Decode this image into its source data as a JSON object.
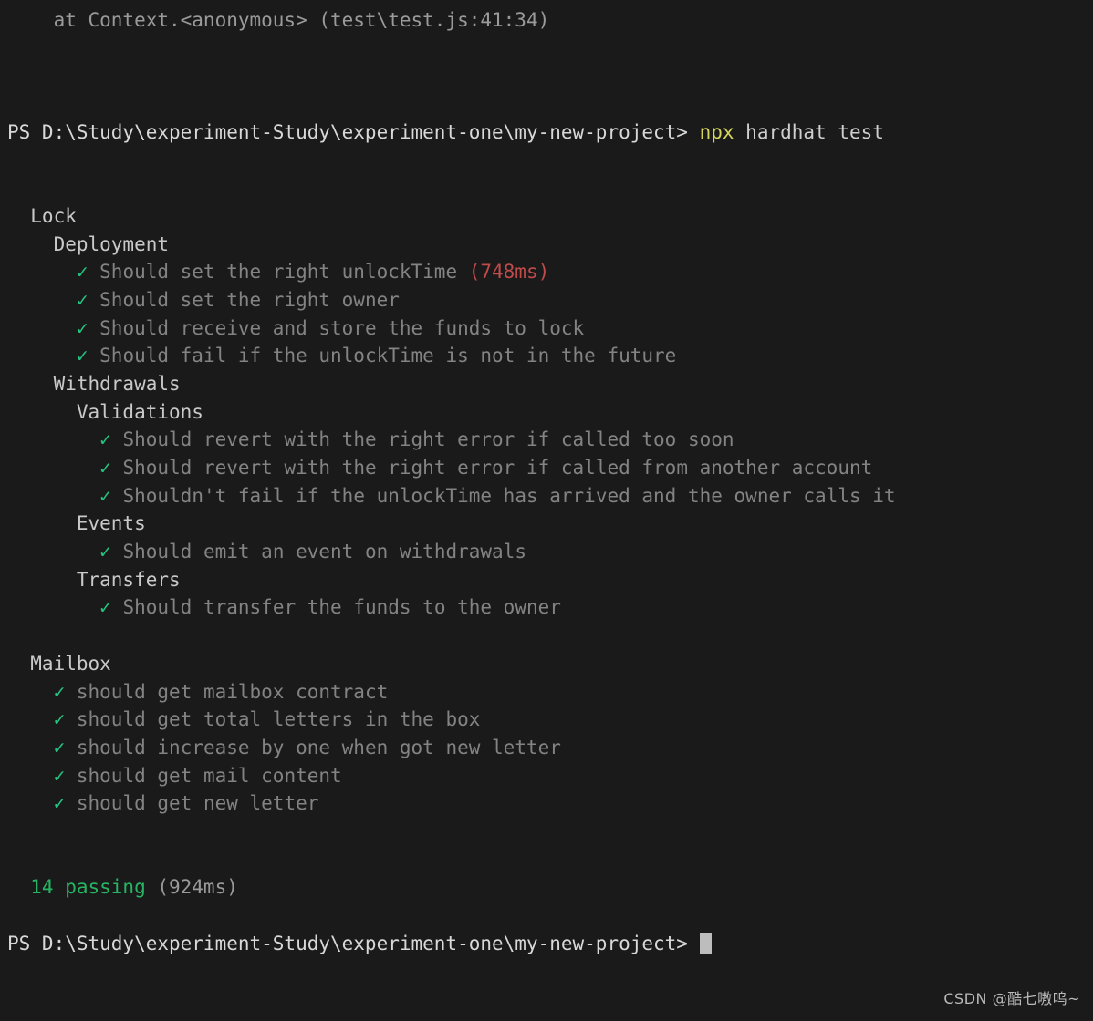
{
  "terminal": {
    "shell": "PowerShell",
    "background_color": "#1a1a1a",
    "colors": {
      "default_text": "#cfcfcf",
      "suite_heading": "#c9c9c9",
      "test_description": "#838383",
      "checkmark_green": "#26c281",
      "passing_green": "#27b563",
      "slow_duration_red": "#bf4b4b",
      "command_yellow": "#d6d65e",
      "cursor": "#bdbdbd"
    },
    "stack_trace_line": "    at Context.<anonymous> (test\\test.js:41:34)",
    "prompt": "PS D:\\Study\\experiment-Study\\experiment-one\\my-new-project>",
    "command": {
      "program": "npx",
      "args": "hardhat test"
    },
    "checkmark_glyph": "✓",
    "cursor_glyph": "block-cursor"
  },
  "test_output": {
    "suites": [
      {
        "name": "Lock",
        "indent": 2,
        "tests": [],
        "children": [
          {
            "name": "Deployment",
            "indent": 4,
            "tests": [
              {
                "title": "Should set the right unlockTime",
                "duration": "(748ms)",
                "duration_slow": true,
                "indent": 6
              },
              {
                "title": "Should set the right owner",
                "duration": "",
                "duration_slow": false,
                "indent": 6
              },
              {
                "title": "Should receive and store the funds to lock",
                "duration": "",
                "duration_slow": false,
                "indent": 6
              },
              {
                "title": "Should fail if the unlockTime is not in the future",
                "duration": "",
                "duration_slow": false,
                "indent": 6
              }
            ],
            "children": []
          },
          {
            "name": "Withdrawals",
            "indent": 4,
            "tests": [],
            "children": [
              {
                "name": "Validations",
                "indent": 6,
                "tests": [
                  {
                    "title": "Should revert with the right error if called too soon",
                    "duration": "",
                    "duration_slow": false,
                    "indent": 8
                  },
                  {
                    "title": "Should revert with the right error if called from another account",
                    "duration": "",
                    "duration_slow": false,
                    "indent": 8
                  },
                  {
                    "title": "Shouldn't fail if the unlockTime has arrived and the owner calls it",
                    "duration": "",
                    "duration_slow": false,
                    "indent": 8
                  }
                ],
                "children": []
              },
              {
                "name": "Events",
                "indent": 6,
                "tests": [
                  {
                    "title": "Should emit an event on withdrawals",
                    "duration": "",
                    "duration_slow": false,
                    "indent": 8
                  }
                ],
                "children": []
              },
              {
                "name": "Transfers",
                "indent": 6,
                "tests": [
                  {
                    "title": "Should transfer the funds to the owner",
                    "duration": "",
                    "duration_slow": false,
                    "indent": 8
                  }
                ],
                "children": []
              }
            ]
          }
        ]
      },
      {
        "name": "Mailbox",
        "indent": 2,
        "tests": [
          {
            "title": "should get mailbox contract",
            "duration": "",
            "duration_slow": false,
            "indent": 4
          },
          {
            "title": "should get total letters in the box",
            "duration": "",
            "duration_slow": false,
            "indent": 4
          },
          {
            "title": "should increase by one when got new letter",
            "duration": "",
            "duration_slow": false,
            "indent": 4
          },
          {
            "title": "should get mail content",
            "duration": "",
            "duration_slow": false,
            "indent": 4
          },
          {
            "title": "should get new letter",
            "duration": "",
            "duration_slow": false,
            "indent": 4
          }
        ],
        "children": []
      }
    ],
    "summary": {
      "count": "14",
      "label": "passing",
      "duration": "(924ms)"
    }
  },
  "watermark": {
    "text": "CSDN @酷七嗷呜~"
  }
}
